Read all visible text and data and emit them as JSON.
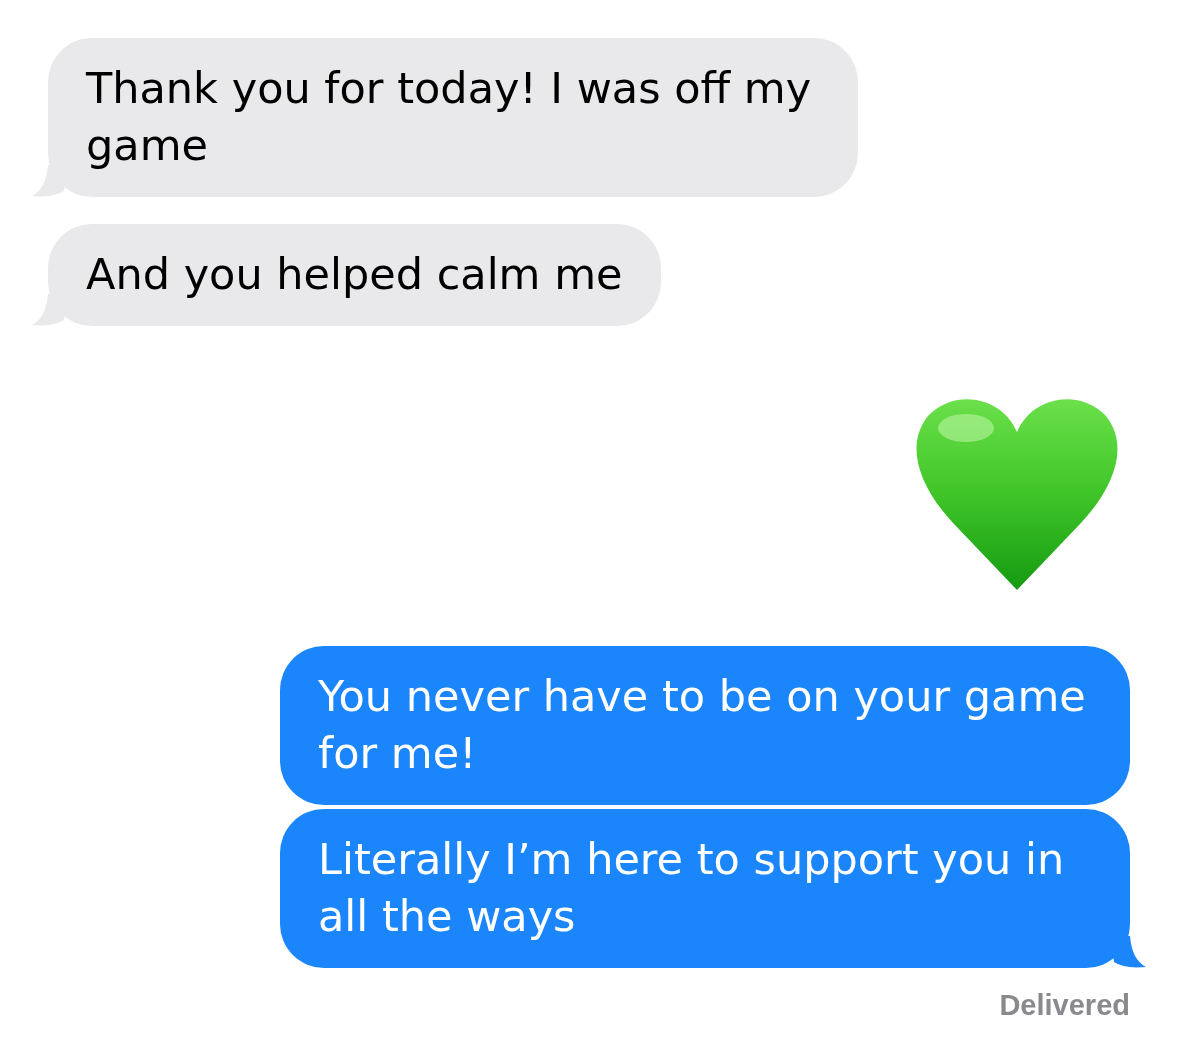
{
  "messages": [
    {
      "outgoing": false,
      "kind": "text",
      "text": "Thank you for today! I was off my game",
      "tail": true
    },
    {
      "outgoing": false,
      "kind": "text",
      "text": "And you helped calm me",
      "tail": true
    },
    {
      "kind": "emoji"
    },
    {
      "outgoing": true,
      "kind": "text",
      "text": "You never have to be on your game for me!",
      "tail": false
    },
    {
      "outgoing": true,
      "kind": "text",
      "text": "Literally I’m here to support you in all the ways",
      "tail": true
    }
  ],
  "status": "Delivered"
}
